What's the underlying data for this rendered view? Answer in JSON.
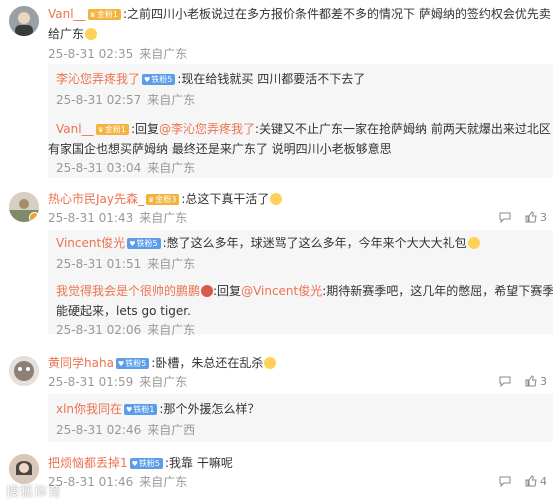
{
  "comments": [
    {
      "user": "Vanl__",
      "badge": "金粉1",
      "text_line1": ":之前四川小老板说过在多方报价条件都差不多的情况下 萨姆纳的签约权会优先卖",
      "text_line2": "给广东",
      "date": "25-8-31 02:35",
      "location": "来自广东",
      "replies": [
        {
          "user": "李沁您弄疼我了",
          "badge": "铁粉5",
          "text": ":现在给钱就买 四川都要活不下去了",
          "date": "25-8-31 02:57",
          "location": "来自广东"
        },
        {
          "user": "Vanl__",
          "badge": "金粉1",
          "prefix": ":回复",
          "mention": "@李沁您弄疼我了",
          "text_line1": ":关键又不止广东一家在抢萨姆纳  前两天就爆出来过北区",
          "text_line2": "有家国企也想买萨姆纳 最终还是来广东了 说明四川小老板够意思",
          "date": "25-8-31 03:04",
          "location": "来自广东"
        }
      ]
    },
    {
      "user": "热心市民Jay先森_",
      "badge": "金粉3",
      "text": ":总这下真干活了",
      "date": "25-8-31 01:43",
      "location": "来自广东",
      "likes": "3",
      "replies": [
        {
          "user": "Vincent俊光",
          "badge": "铁粉5",
          "text": ":憋了这么多年，球迷骂了这么多年，今年来个大大大礼包",
          "date": "25-8-31 01:51",
          "location": "来自广东"
        },
        {
          "user": "我觉得我会是个很帅的鹏鹏",
          "prefix": ":回复",
          "mention": "@Vincent俊光",
          "text_line1": ":期待新赛季吧，这几年的憋屈，希望下赛季",
          "text_line2": "能硬起来，lets go tiger.",
          "date": "25-8-31 02:06",
          "location": "来自广东"
        }
      ]
    },
    {
      "user": "黄同学haha",
      "badge": "铁粉5",
      "text": ":卧槽，朱总还在乱杀",
      "date": "25-8-31 01:59",
      "location": "来自广东",
      "likes": "3",
      "replies": [
        {
          "user": "xln你我同在",
          "badge": "铁粉1",
          "text": ":那个外援怎么样？",
          "date": "25-8-31 02:46",
          "location": "来自广西"
        }
      ]
    },
    {
      "user": "把烦恼都丢掉1",
      "badge": "铁粉5",
      "text": ":我靠 干嘛呢",
      "date": "25-8-31 01:46",
      "location": "来自广东",
      "likes": "4"
    }
  ],
  "watermark": "搜狐体育"
}
